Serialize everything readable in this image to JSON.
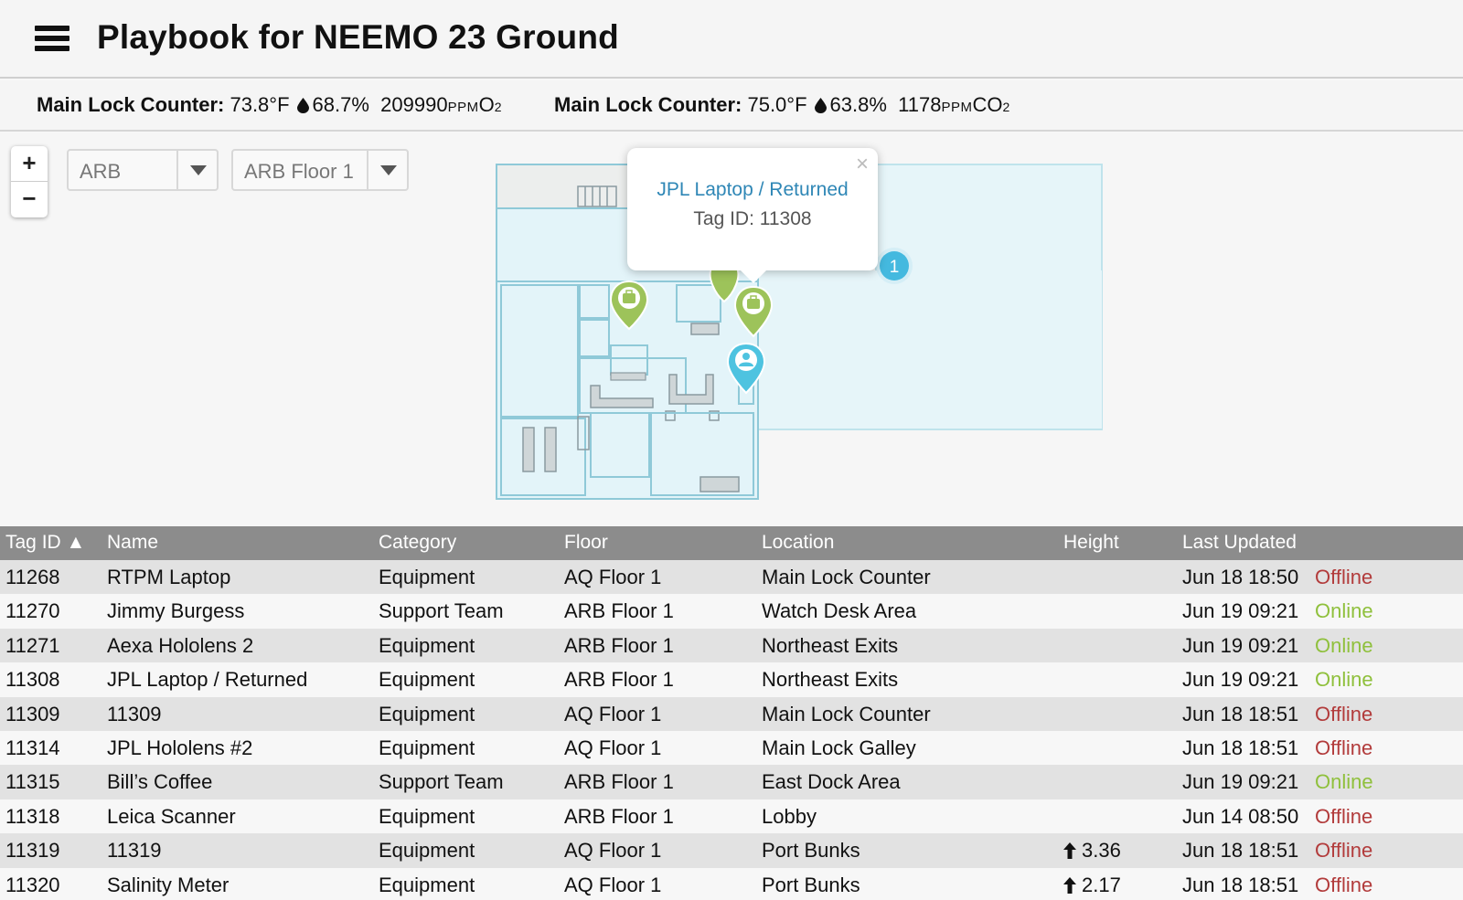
{
  "header": {
    "title": "Playbook for NEEMO 23 Ground"
  },
  "sensors": [
    {
      "label": "Main Lock Counter:",
      "temp": "73.8°F",
      "humidity": "68.7%",
      "gas_value": "209990",
      "gas_unit": "PPM",
      "gas_name": "O",
      "gas_sub": "2"
    },
    {
      "label": "Main Lock Counter:",
      "temp": "75.0°F",
      "humidity": "63.8%",
      "gas_value": "1178",
      "gas_unit": "PPM",
      "gas_name": "CO",
      "gas_sub": "2"
    }
  ],
  "map": {
    "zoom_in": "+",
    "zoom_out": "−",
    "building_select": "ARB",
    "floor_select": "ARB Floor 1",
    "popup": {
      "close": "×",
      "title": "JPL Laptop / Returned",
      "tag": "Tag ID: 11308"
    },
    "cluster_count": "1",
    "marker_colors": {
      "equipment": "#9dc35a",
      "person": "#4ec3e0",
      "cluster": "#44b9df"
    }
  },
  "table": {
    "headers": {
      "tag_id": "Tag ID ▲",
      "name": "Name",
      "category": "Category",
      "floor": "Floor",
      "location": "Location",
      "height": "Height",
      "last_updated": "Last Updated"
    },
    "rows": [
      {
        "tag_id": "11268",
        "name": "RTPM Laptop",
        "category": "Equipment",
        "floor": "AQ Floor 1",
        "location": "Main Lock Counter",
        "height": "",
        "last_updated": "Jun 18 18:50",
        "status": "Offline"
      },
      {
        "tag_id": "11270",
        "name": "Jimmy Burgess",
        "category": "Support Team",
        "floor": "ARB Floor 1",
        "location": "Watch Desk Area",
        "height": "",
        "last_updated": "Jun 19 09:21",
        "status": "Online"
      },
      {
        "tag_id": "11271",
        "name": "Aexa Hololens 2",
        "category": "Equipment",
        "floor": "ARB Floor 1",
        "location": "Northeast Exits",
        "height": "",
        "last_updated": "Jun 19 09:21",
        "status": "Online"
      },
      {
        "tag_id": "11308",
        "name": "JPL Laptop / Returned",
        "category": "Equipment",
        "floor": "ARB Floor 1",
        "location": "Northeast Exits",
        "height": "",
        "last_updated": "Jun 19 09:21",
        "status": "Online"
      },
      {
        "tag_id": "11309",
        "name": "11309",
        "category": "Equipment",
        "floor": "AQ Floor 1",
        "location": "Main Lock Counter",
        "height": "",
        "last_updated": "Jun 18 18:51",
        "status": "Offline"
      },
      {
        "tag_id": "11314",
        "name": "JPL Hololens #2",
        "category": "Equipment",
        "floor": "AQ Floor 1",
        "location": "Main Lock Galley",
        "height": "",
        "last_updated": "Jun 18 18:51",
        "status": "Offline"
      },
      {
        "tag_id": "11315",
        "name": "Bill’s Coffee",
        "category": "Support Team",
        "floor": "ARB Floor 1",
        "location": "East Dock Area",
        "height": "",
        "last_updated": "Jun 19 09:21",
        "status": "Online"
      },
      {
        "tag_id": "11318",
        "name": "Leica Scanner",
        "category": "Equipment",
        "floor": "ARB Floor 1",
        "location": "Lobby",
        "height": "",
        "last_updated": "Jun 14 08:50",
        "status": "Offline"
      },
      {
        "tag_id": "11319",
        "name": "11319",
        "category": "Equipment",
        "floor": "AQ Floor 1",
        "location": "Port Bunks",
        "height": "3.36",
        "last_updated": "Jun 18 18:51",
        "status": "Offline"
      },
      {
        "tag_id": "11320",
        "name": "Salinity Meter",
        "category": "Equipment",
        "floor": "AQ Floor 1",
        "location": "Port Bunks",
        "height": "2.17",
        "last_updated": "Jun 18 18:51",
        "status": "Offline"
      }
    ]
  }
}
